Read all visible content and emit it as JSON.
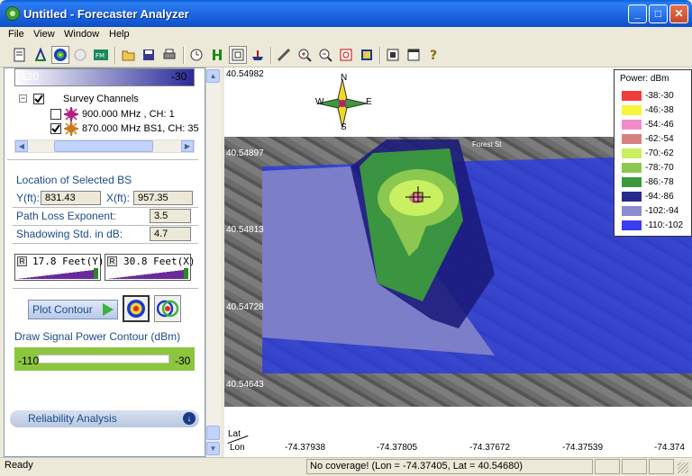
{
  "window": {
    "title": "Untitled - Forecaster Analyzer",
    "minimize": "_",
    "maximize": "□",
    "close": "✕"
  },
  "menu": [
    "File",
    "View",
    "Window",
    "Help"
  ],
  "toolbar_icons": [
    "new-doc-icon",
    "antenna-icon",
    "coverage-icon",
    "circle-icon",
    "fm-icon",
    "open-folder-icon",
    "save-icon",
    "print-icon",
    "clock-icon",
    "tower-icon",
    "frame-icon",
    "ship-icon",
    "ruler-icon",
    "zoom-in-icon",
    "zoom-out-icon",
    "fit-icon",
    "image-icon",
    "capture-icon",
    "window-icon",
    "help-icon"
  ],
  "top_slider": {
    "min": "-120",
    "max": "-30"
  },
  "survey": {
    "root": "Survey Channels",
    "items": [
      {
        "label": "900.000 MHz , CH: 1",
        "checked": false,
        "color": "#b0207a"
      },
      {
        "label": "870.000 MHz BS1, CH: 35",
        "checked": true,
        "color": "#c87a1a"
      }
    ]
  },
  "location": {
    "heading": "Location of Selected BS",
    "y_label": "Y(ft):",
    "y_value": "831.43",
    "x_label": "X(ft):",
    "x_value": "957.35",
    "ple_label": "Path Loss Exponent:",
    "ple_value": "3.5",
    "shadow_label": "Shadowing Std. in dB:",
    "shadow_value": "4.7"
  },
  "feet": {
    "y": "17.8 Feet(Y)",
    "x": "30.8 Feet(X)"
  },
  "plot_contour": "Plot Contour",
  "draw_label": "Draw Signal Power Contour (dBm)",
  "contour_slider": {
    "min": "-110",
    "max": "-30"
  },
  "reliability": "Reliability Analysis",
  "map": {
    "y_ticks": [
      "40.54982",
      "40.54897",
      "40.54813",
      "40.54728",
      "40.54643"
    ],
    "x_ticks": [
      "-74.37938",
      "-74.37805",
      "-74.37672",
      "-74.37539",
      "-74.374"
    ],
    "lat_label": "Lat",
    "lon_label": "Lon",
    "compass": {
      "n": "N",
      "s": "S",
      "e": "E",
      "w": "W"
    },
    "street": "Forest St"
  },
  "legend": {
    "title": "Power: dBm",
    "rows": [
      {
        "label": "-38:-30",
        "color": "#f23c3c"
      },
      {
        "label": "-46:-38",
        "color": "#f5f53c"
      },
      {
        "label": "-54:-46",
        "color": "#f28cc8"
      },
      {
        "label": "-62:-54",
        "color": "#d88080"
      },
      {
        "label": "-70:-62",
        "color": "#c8f060"
      },
      {
        "label": "-78:-70",
        "color": "#8cc850"
      },
      {
        "label": "-86:-78",
        "color": "#3c9a3c"
      },
      {
        "label": "-94:-86",
        "color": "#2a2a8c"
      },
      {
        "label": "-102:-94",
        "color": "#8c8cd0"
      },
      {
        "label": "-110:-102",
        "color": "#3c3cf0"
      }
    ]
  },
  "status": {
    "ready": "Ready",
    "message": "No coverage! (Lon = -74.37405, Lat = 40.54680)"
  }
}
